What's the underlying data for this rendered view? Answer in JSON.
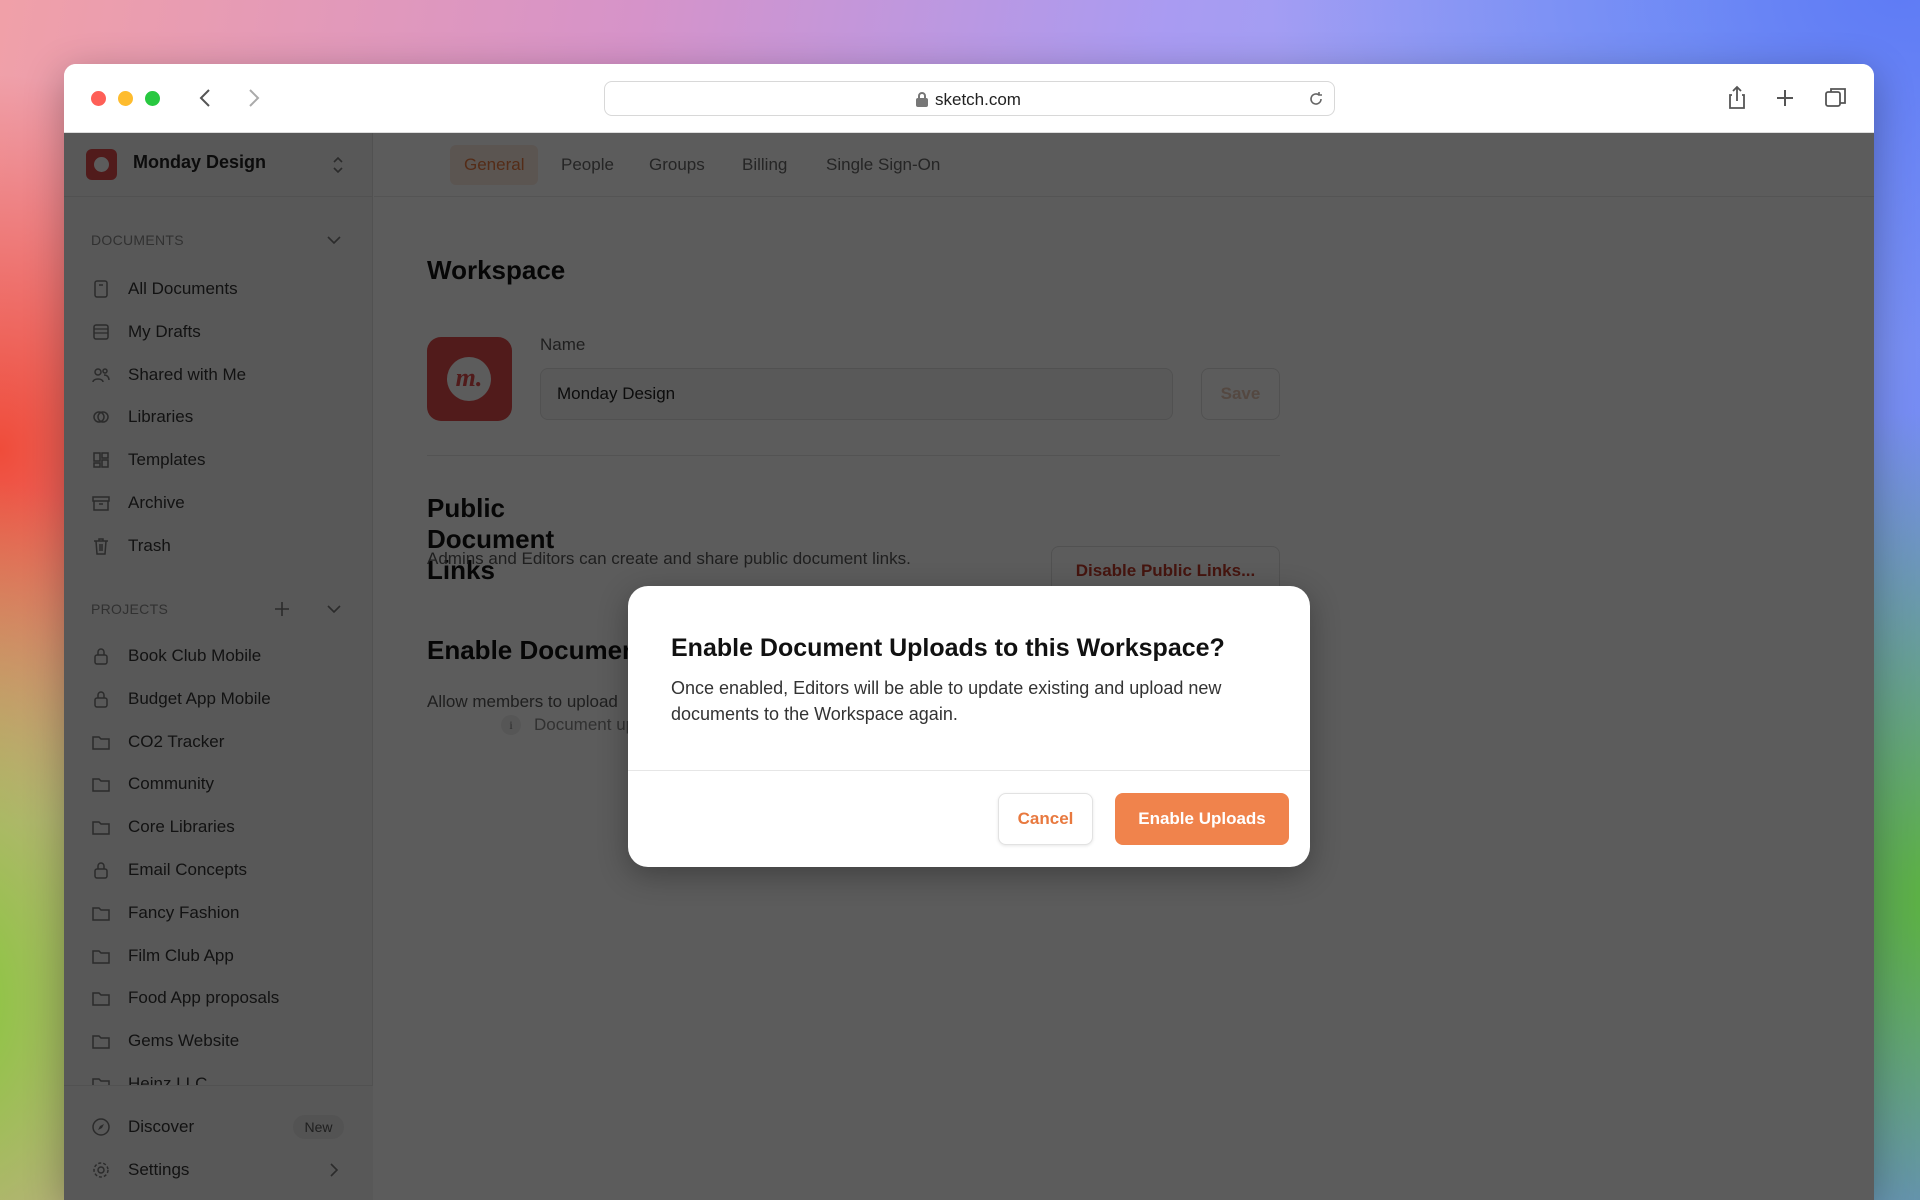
{
  "browser": {
    "url": "sketch.com",
    "icons": [
      "back-icon",
      "forward-icon",
      "lock-icon",
      "reload-icon",
      "share-icon",
      "new-tab-icon",
      "tabs-overview-icon"
    ]
  },
  "sidebar": {
    "workspace_name": "Monday Design",
    "documents_label": "DOCUMENTS",
    "documents": [
      {
        "label": "All Documents",
        "icon": "document-icon"
      },
      {
        "label": "My Drafts",
        "icon": "drafts-icon"
      },
      {
        "label": "Shared with Me",
        "icon": "people-icon"
      },
      {
        "label": "Libraries",
        "icon": "library-icon"
      },
      {
        "label": "Templates",
        "icon": "templates-icon"
      },
      {
        "label": "Archive",
        "icon": "archive-icon"
      },
      {
        "label": "Trash",
        "icon": "trash-icon"
      }
    ],
    "projects_label": "PROJECTS",
    "projects": [
      {
        "label": "Book Club Mobile",
        "icon": "lock-icon"
      },
      {
        "label": "Budget App Mobile",
        "icon": "lock-icon"
      },
      {
        "label": "CO2 Tracker",
        "icon": "folder-icon"
      },
      {
        "label": "Community",
        "icon": "folder-icon"
      },
      {
        "label": "Core Libraries",
        "icon": "folder-icon"
      },
      {
        "label": "Email Concepts",
        "icon": "lock-icon"
      },
      {
        "label": "Fancy Fashion",
        "icon": "folder-icon"
      },
      {
        "label": "Film Club App",
        "icon": "folder-icon"
      },
      {
        "label": "Food App proposals",
        "icon": "folder-icon"
      },
      {
        "label": "Gems Website",
        "icon": "folder-icon"
      },
      {
        "label": "Heinz LLC",
        "icon": "folder-icon"
      }
    ],
    "discover": "Discover",
    "new_badge": "New",
    "settings": "Settings"
  },
  "tabs": [
    {
      "label": "General",
      "active": true
    },
    {
      "label": "People"
    },
    {
      "label": "Groups"
    },
    {
      "label": "Billing"
    },
    {
      "label": "Single Sign-On"
    }
  ],
  "main": {
    "workspace_title": "Workspace",
    "name_label": "Name",
    "name_value": "Monday Design",
    "save": "Save",
    "public_title": "Public Document Links",
    "public_desc": "Admins and Editors can create and share public document links.",
    "disable_links": "Disable Public Links...",
    "uploads_title": "Enable Document Uploads",
    "uploads_desc": "Allow members to upload",
    "uploads_note": "Document uploads"
  },
  "dialog": {
    "title": "Enable Document Uploads to this Workspace?",
    "body": "Once enabled, Editors will be able to update existing and upload new documents to the Workspace again.",
    "cancel": "Cancel",
    "confirm": "Enable Uploads"
  },
  "colors": {
    "accent": "#f0834c",
    "danger": "#c0392b"
  }
}
